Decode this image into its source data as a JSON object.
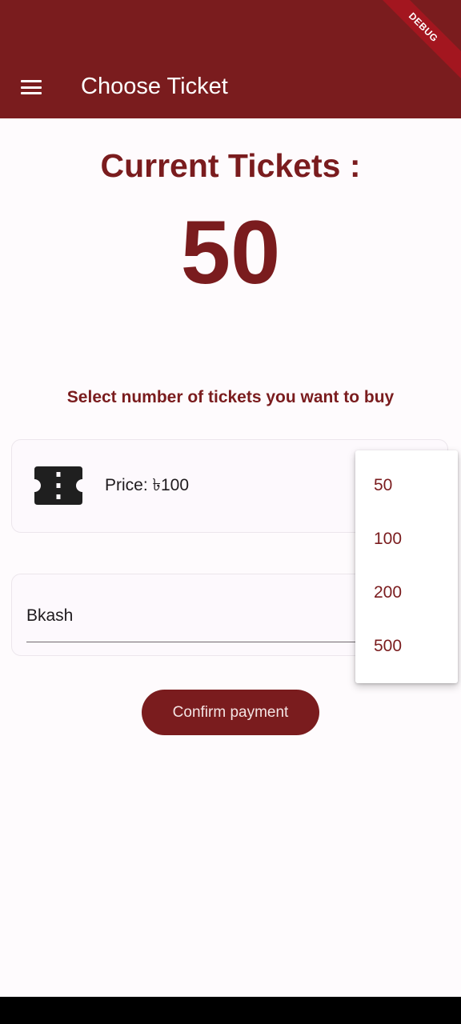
{
  "appbar": {
    "title": "Choose Ticket",
    "menu_icon": "hamburger-menu-icon",
    "debug_label": "DEBUG",
    "color": "#7a1c1e"
  },
  "tickets": {
    "current_label": "Current Tickets :",
    "current_count": "50",
    "instruction": "Select number of tickets you want to buy"
  },
  "ticket_card": {
    "icon": "ticket-icon",
    "price_text": "Price: ৳100"
  },
  "payment": {
    "method_value": "Bkash"
  },
  "dropdown": {
    "options": [
      "50",
      "100",
      "200",
      "500"
    ]
  },
  "actions": {
    "confirm_label": "Confirm payment"
  }
}
